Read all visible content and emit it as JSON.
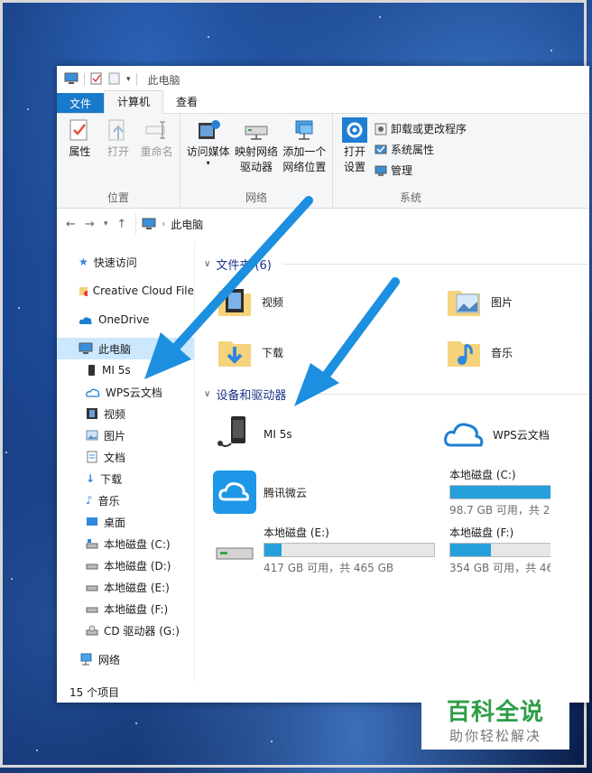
{
  "window": {
    "title": "此电脑"
  },
  "ribbon": {
    "tabs": [
      {
        "label": "文件"
      },
      {
        "label": "计算机"
      },
      {
        "label": "查看"
      }
    ],
    "groups": {
      "location": {
        "label": "位置",
        "buttons": [
          {
            "label": "属性"
          },
          {
            "label": "打开"
          },
          {
            "label": "重命名"
          }
        ]
      },
      "network": {
        "label": "网络",
        "buttons": [
          {
            "label": "访问媒体"
          },
          {
            "label": "映射网络\n驱动器"
          },
          {
            "label": "添加一个\n网络位置"
          }
        ]
      },
      "system": {
        "label": "系统",
        "open": "打开\n设置",
        "items": [
          {
            "label": "卸载或更改程序"
          },
          {
            "label": "系统属性"
          },
          {
            "label": "管理"
          }
        ]
      }
    }
  },
  "address": {
    "path": "此电脑"
  },
  "nav": {
    "quick_access": "快速访问",
    "creative_cloud": "Creative Cloud File",
    "onedrive": "OneDrive",
    "this_pc": "此电脑",
    "children": [
      {
        "label": "MI 5s"
      },
      {
        "label": "WPS云文档"
      },
      {
        "label": "视频"
      },
      {
        "label": "图片"
      },
      {
        "label": "文档"
      },
      {
        "label": "下载"
      },
      {
        "label": "音乐"
      },
      {
        "label": "桌面"
      },
      {
        "label": "本地磁盘 (C:)"
      },
      {
        "label": "本地磁盘 (D:)"
      },
      {
        "label": "本地磁盘 (E:)"
      },
      {
        "label": "本地磁盘 (F:)"
      },
      {
        "label": "CD 驱动器 (G:)"
      }
    ],
    "network": "网络"
  },
  "content": {
    "folders_header": "文件夹 (6)",
    "folders": [
      {
        "label": "视频"
      },
      {
        "label": "图片"
      },
      {
        "label": "下载"
      },
      {
        "label": "音乐"
      }
    ],
    "devices_header": "设备和驱动器",
    "devices": [
      {
        "label": "MI 5s"
      },
      {
        "label": "WPS云文档"
      },
      {
        "label": "腾讯微云"
      },
      {
        "label": "本地磁盘 (C:)",
        "sub": "98.7 GB 可用，共 2",
        "fill": 0.76
      },
      {
        "label": "本地磁盘 (E:)",
        "sub": "417 GB 可用，共 465 GB",
        "fill": 0.1
      },
      {
        "label": "本地磁盘 (F:)",
        "sub": "354 GB 可用，共 46",
        "fill": 0.24
      }
    ]
  },
  "status": {
    "count": "15 个项目"
  },
  "watermark": {
    "title": "百科全说",
    "subtitle": "助你轻松解决"
  },
  "colors": {
    "accent": "#1979ca",
    "arrow": "#1c8fe0",
    "bar": "#26a0da",
    "watermark": "#2e9e47"
  }
}
